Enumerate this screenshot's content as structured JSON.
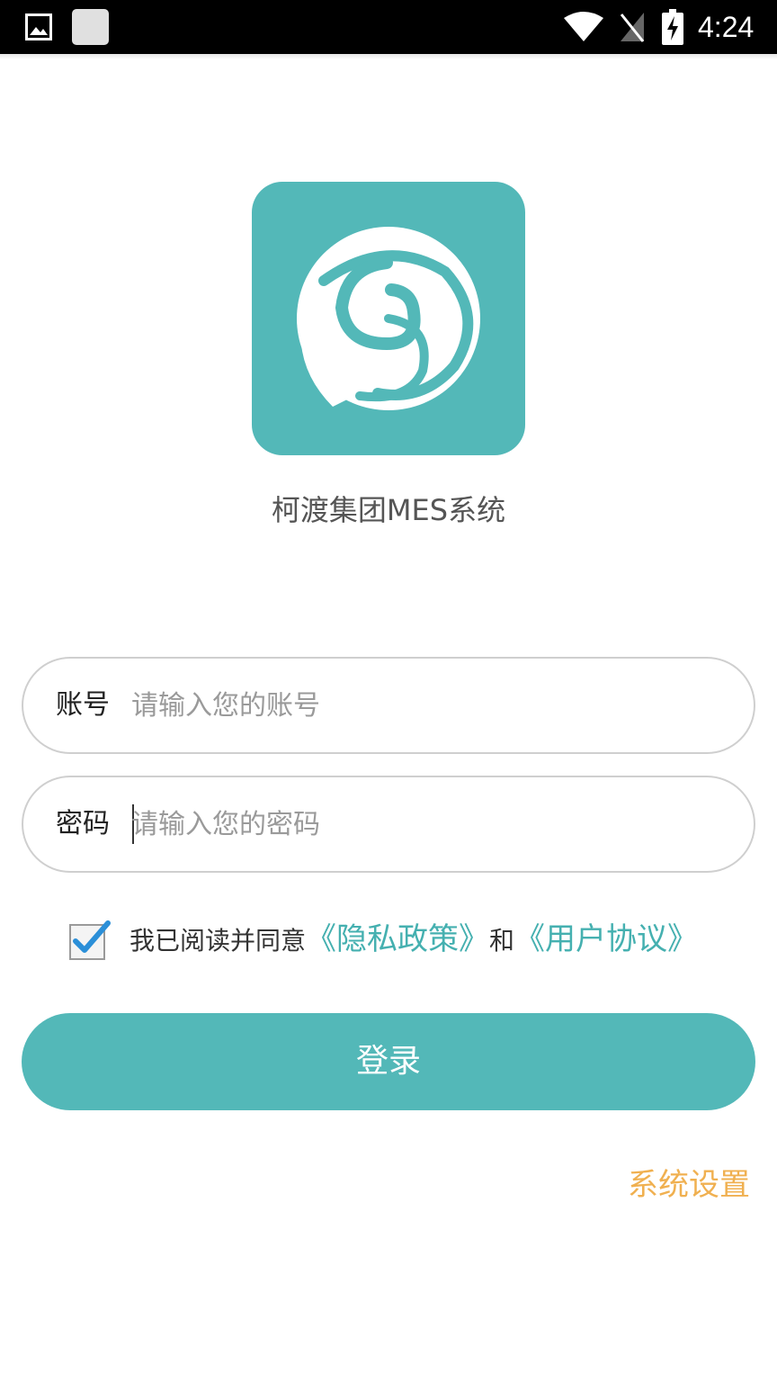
{
  "status_bar": {
    "time": "4:24"
  },
  "app": {
    "name": "柯渡集团MES系统",
    "brand_color": "#53b8b8"
  },
  "form": {
    "account": {
      "label": "账号",
      "placeholder": "请输入您的账号"
    },
    "password": {
      "label": "密码",
      "placeholder": "请输入您的密码"
    },
    "agreement": {
      "checked": true,
      "text": "我已阅读并同意",
      "privacy_link": "《隐私政策》",
      "and": "和",
      "terms_link": "《用户协议》"
    },
    "login_label": "登录"
  },
  "settings_link": "系统设置",
  "accent_color": "#f0b050"
}
